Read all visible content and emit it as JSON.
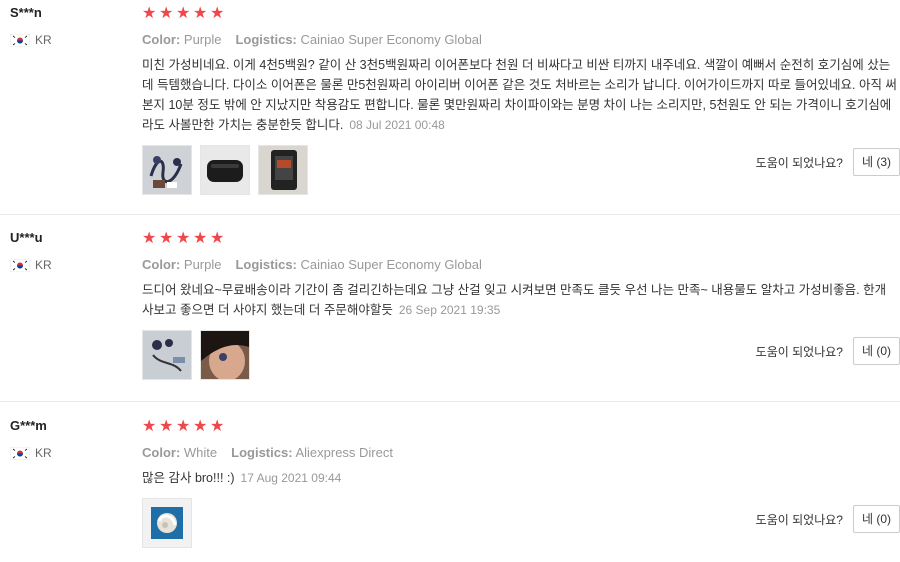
{
  "colors": {
    "star": "#f0474b",
    "muted": "#999999",
    "text": "#333333",
    "divider": "#e8e8e8"
  },
  "icons": {
    "star": "star-icon",
    "flag": "korea-flag-icon"
  },
  "labels": {
    "color": "Color:",
    "logistics": "Logistics:",
    "helpful_question": "도움이 되었나요?"
  },
  "reviews": [
    {
      "user": "S***n",
      "country": "KR",
      "rating": 5,
      "color": "Purple",
      "logistics": "Cainiao Super Economy Global",
      "text": "미친 가성비네요. 이게 4천5백원? 같이 산 3천5백원짜리 이어폰보다 천원 더 비싸다고 비싼 티까지 내주네요. 색깔이 예뻐서 순전히 호기심에 샀는데 득템했습니다. 다이소 이어폰은 물론 만5천원짜리 아이리버 이어폰 같은 것도 처바르는 소리가 납니다. 이어가이드까지 따로 들어있네요. 아직 써본지 10분 정도 밖에 안 지났지만 착용감도 편합니다. 물론 몇만원짜리 차이파이와는 분명 차이 나는 소리지만, 5천원도 안 되는 가격이니 호기심에라도 사볼만한 가치는 충분한듯 합니다.",
      "date": "08 Jul 2021 00:48",
      "thumbnails": [
        "earphones-photo",
        "case-photo",
        "package-photo"
      ],
      "helpful_button": "네 (3)"
    },
    {
      "user": "U***u",
      "country": "KR",
      "rating": 5,
      "color": "Purple",
      "logistics": "Cainiao Super Economy Global",
      "text": "드디어 왔네요~무료배송이라 기간이 좀 걸리긴하는데요 그냥 산걸 잊고 시켜보면 만족도 클듯 우선 나는 만족~ 내용물도 알차고 가성비좋음. 한개 사보고 좋으면 더 사야지 했는데 더 주문해야할듯",
      "date": "26 Sep 2021 19:35",
      "thumbnails": [
        "contents-photo",
        "ear-photo"
      ],
      "helpful_button": "네 (0)"
    },
    {
      "user": "G***m",
      "country": "KR",
      "rating": 5,
      "color": "White",
      "logistics": "Aliexpress Direct",
      "text": "많은 감사 bro!!! :)",
      "date": "17 Aug 2021 09:44",
      "thumbnails": [
        "white-earphones-photo"
      ],
      "helpful_button": "네 (0)"
    }
  ]
}
